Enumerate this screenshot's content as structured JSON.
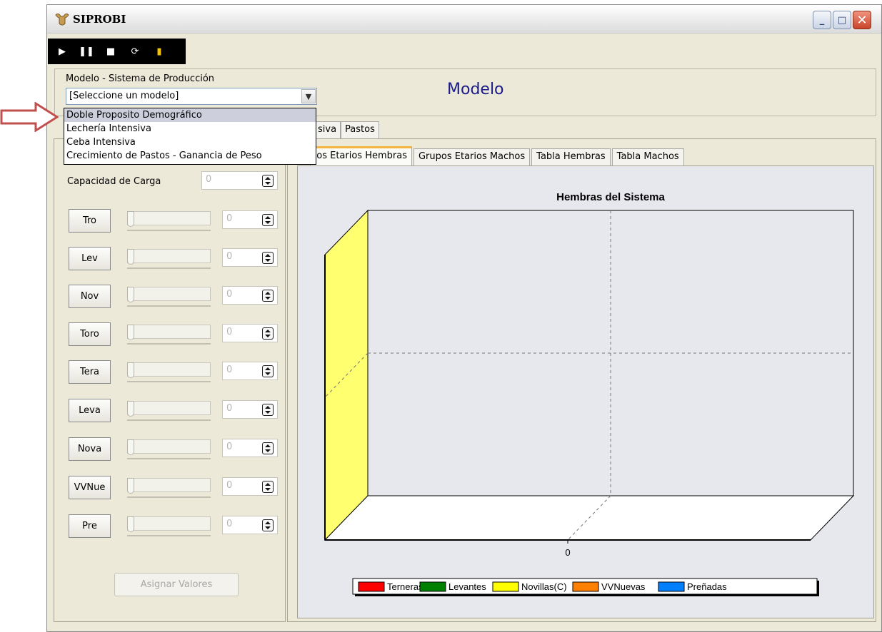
{
  "window": {
    "title": "SIPROBI"
  },
  "model": {
    "label": "Modelo - Sistema de Producción",
    "selected": "[Seleccione un modelo]",
    "heading": "Modelo",
    "options": [
      "Doble Proposito Demográfico",
      "Lechería Intensiva",
      "Ceba Intensiva",
      "Crecimiento de Pastos - Ganancia de Peso"
    ]
  },
  "outer_tabs": [
    "siva",
    "Pastos"
  ],
  "left_panel": {
    "capacity_label": "Capacidad de Carga",
    "capacity_value": "0",
    "rows": [
      {
        "label": "Tro",
        "value": "0"
      },
      {
        "label": "Lev",
        "value": "0"
      },
      {
        "label": "Nov",
        "value": "0"
      },
      {
        "label": "Toro",
        "value": "0"
      },
      {
        "label": "Tera",
        "value": "0"
      },
      {
        "label": "Leva",
        "value": "0"
      },
      {
        "label": "Nova",
        "value": "0"
      },
      {
        "label": "VVNue",
        "value": "0"
      },
      {
        "label": "Pre",
        "value": "0"
      }
    ],
    "assign_button": "Asignar Valores"
  },
  "inner_tabs": [
    "pos Etarios Hembras",
    "Grupos Etarios Machos",
    "Tabla Hembras",
    "Tabla Machos"
  ],
  "chart_data": {
    "type": "bar",
    "title": "Hembras del Sistema",
    "categories": [
      "0"
    ],
    "series": [
      {
        "name": "Terneras",
        "color": "#ff0000",
        "values": [
          0
        ]
      },
      {
        "name": "Levantes",
        "color": "#008000",
        "values": [
          0
        ]
      },
      {
        "name": "Novillas(C)",
        "color": "#ffff00",
        "values": [
          0
        ]
      },
      {
        "name": "VVNuevas",
        "color": "#ff7f00",
        "values": [
          0
        ]
      },
      {
        "name": "Preñadas",
        "color": "#0080ff",
        "values": [
          0
        ]
      }
    ],
    "grid": true,
    "three_d": true,
    "legend_position": "bottom"
  }
}
